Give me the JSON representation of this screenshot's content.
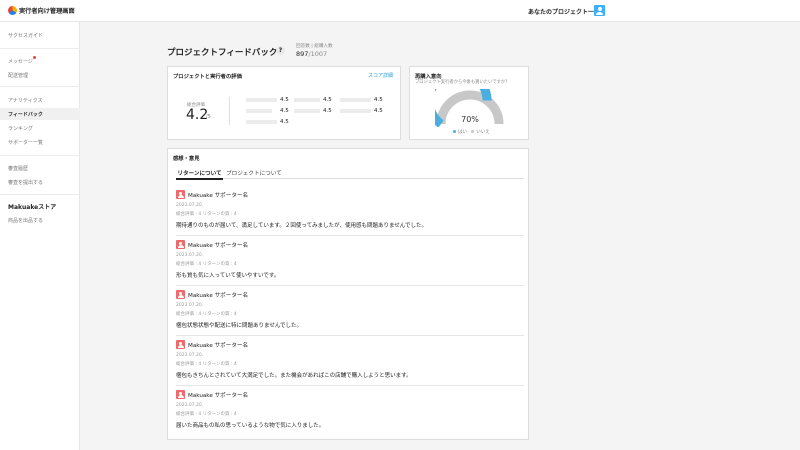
{
  "header": {
    "app_title": "実行者向け管理画面",
    "project_list_link": "あなたのプロジェクト一覧"
  },
  "sidebar": {
    "items": [
      {
        "label": "サクセスガイド"
      },
      {
        "label": "メッセージ"
      },
      {
        "label": "配送管理"
      },
      {
        "label": "アナリティクス"
      },
      {
        "label": "フィードバック"
      },
      {
        "label": "ランキング"
      },
      {
        "label": "サポーター一覧"
      },
      {
        "label": "審査履歴"
      },
      {
        "label": "審査を提出する"
      }
    ],
    "store_title": "Makuakeストア",
    "store_item": "商品を出品する"
  },
  "page": {
    "title": "プロジェクトフィードバック",
    "help_label": "?",
    "respondents_label": "回答数 | 総購入数",
    "respondents_count": "897",
    "respondents_total": "/1007"
  },
  "evaluation": {
    "title": "プロジェクトと実行者の評価",
    "link": "スコア詳細",
    "average_label": "総合評価",
    "average_value": "4.2",
    "average_denominator": "/5",
    "scores": [
      "4.5",
      "4.5",
      "4.5",
      "4.5",
      "4.5",
      "4.5",
      "4.5"
    ]
  },
  "repurchase": {
    "title": "再購入意向",
    "subtitle": "プロジェクト実行者から今後も買いたいですか?",
    "percent": "70%",
    "yes_fraction": 0.7,
    "legend_yes": "はい",
    "legend_no": "いいえ",
    "yes_color": "#4aaee0",
    "no_color": "#c8c8c8"
  },
  "feedback": {
    "title": "感想・意見",
    "tabs": [
      {
        "label": "リターンについて",
        "active": true
      },
      {
        "label": "プロジェクトについて",
        "active": false
      }
    ],
    "reviews": [
      {
        "name": "Makuake サポーター名",
        "date": "2023.07.20.",
        "meta": "総合評価 : 4   リターンの質 : 4",
        "text": "期待通りのものが届いて、満足しています。２回使ってみましたが、使用感も問題ありませんでした。"
      },
      {
        "name": "Makuake サポーター名",
        "date": "2023.07.20.",
        "meta": "総合評価 : 4   リターンの質 : 4",
        "text": "形も質も気に入っていて使いやすいです。"
      },
      {
        "name": "Makuake サポーター名",
        "date": "2023.07.20.",
        "meta": "総合評価 : 4   リターンの質 : 4",
        "text": "梱包状態状態や配送に特に問題ありませんでした。"
      },
      {
        "name": "Makuake サポーター名",
        "date": "2023.07.20.",
        "meta": "総合評価 : 4   リターンの質 : 4",
        "text": "梱包もきちんとされていて大満足でした。また機会があればこの店舗で購入しようと思います。"
      },
      {
        "name": "Makuake サポーター名",
        "date": "2023.07.20.",
        "meta": "総合評価 : 4   リターンの質 : 4",
        "text": "届いた商品もの私の思っているような物で気に入りました。"
      }
    ]
  }
}
